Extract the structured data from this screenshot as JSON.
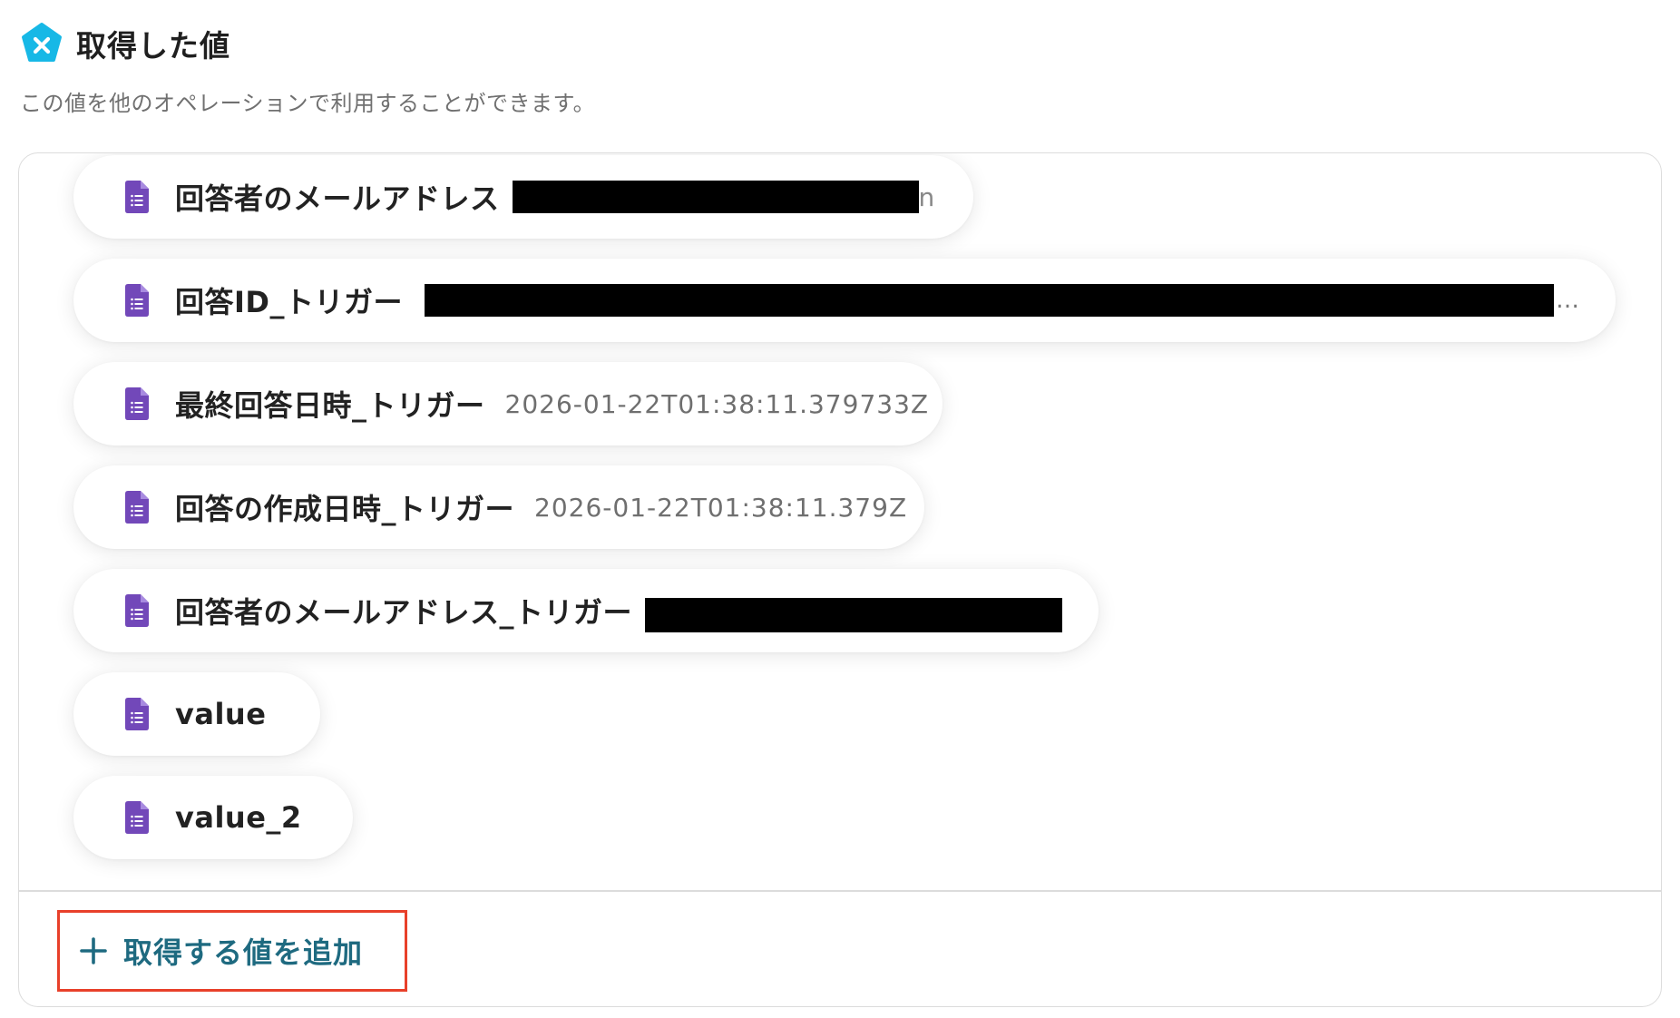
{
  "header": {
    "icon": "yoom-x-pentagon-icon",
    "title": "取得した値"
  },
  "subtitle": "この値を他のオペレーションで利用することができます。",
  "colors": {
    "brand_cyan": "#17b8e6",
    "form_purple": "#7248b9",
    "add_text": "#1e6a80",
    "highlight_red": "#e8402a"
  },
  "items": [
    {
      "label": "回答者のメールアドレス",
      "value": "",
      "redacted": true,
      "trailing": "n",
      "icon": "google-forms-doc-icon"
    },
    {
      "label": "回答ID_トリガー",
      "value": "",
      "redacted": true,
      "trailing": "…",
      "icon": "google-forms-doc-icon"
    },
    {
      "label": "最終回答日時_トリガー",
      "value": "2026-01-22T01:38:11.379733Z",
      "icon": "google-forms-doc-icon"
    },
    {
      "label": "回答の作成日時_トリガー",
      "value": "2026-01-22T01:38:11.379Z",
      "icon": "google-forms-doc-icon"
    },
    {
      "label": "回答者のメールアドレス_トリガー",
      "value": "",
      "redacted": true,
      "icon": "google-forms-doc-icon"
    },
    {
      "label": "value",
      "value": "",
      "icon": "google-forms-doc-icon"
    },
    {
      "label": "value_2",
      "value": "",
      "icon": "google-forms-doc-icon"
    }
  ],
  "add_button": {
    "label": "取得する値を追加",
    "icon": "plus-icon"
  }
}
